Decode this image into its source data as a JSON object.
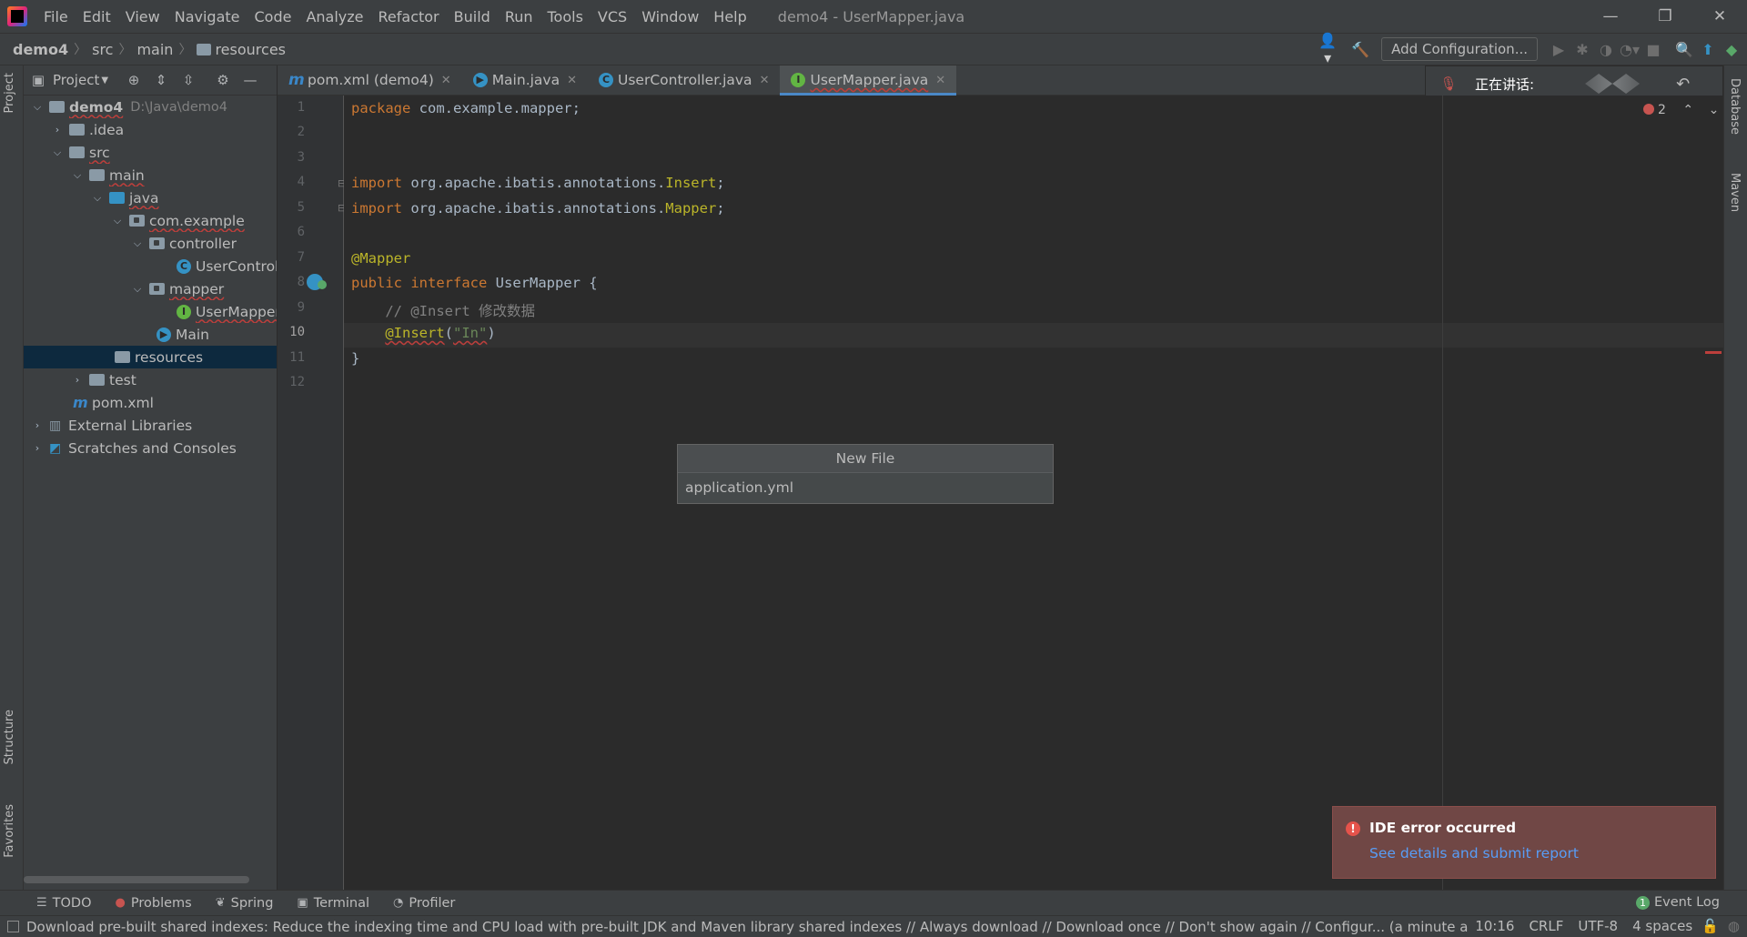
{
  "app": {
    "window_title": "demo4 - UserMapper.java",
    "menu": [
      "File",
      "Edit",
      "View",
      "Navigate",
      "Code",
      "Analyze",
      "Refactor",
      "Build",
      "Run",
      "Tools",
      "VCS",
      "Window",
      "Help"
    ]
  },
  "breadcrumb": [
    "demo4",
    "src",
    "main",
    "resources"
  ],
  "toolbar": {
    "add_configuration": "Add Configuration..."
  },
  "project_panel": {
    "title": "Project",
    "tree": [
      {
        "label": "demo4",
        "path": "D:\\Java\\demo4"
      },
      {
        "label": ".idea"
      },
      {
        "label": "src"
      },
      {
        "label": "main"
      },
      {
        "label": "java"
      },
      {
        "label": "com.example"
      },
      {
        "label": "controller"
      },
      {
        "label": "UserController"
      },
      {
        "label": "mapper"
      },
      {
        "label": "UserMapper"
      },
      {
        "label": "Main"
      },
      {
        "label": "resources"
      },
      {
        "label": "test"
      },
      {
        "label": "pom.xml"
      },
      {
        "label": "External Libraries"
      },
      {
        "label": "Scratches and Consoles"
      }
    ]
  },
  "editor_tabs": [
    {
      "label": "pom.xml (demo4)",
      "icon": "maven-icon"
    },
    {
      "label": "Main.java",
      "icon": "main-class-icon"
    },
    {
      "label": "UserController.java",
      "icon": "class-icon"
    },
    {
      "label": "UserMapper.java",
      "icon": "interface-icon",
      "active": true
    }
  ],
  "speaking_overlay": {
    "label": "正在讲话:"
  },
  "editor": {
    "line_numbers": [
      "1",
      "2",
      "3",
      "4",
      "5",
      "6",
      "7",
      "8",
      "9",
      "10",
      "11",
      "12"
    ],
    "current_line": "10",
    "error_count": "2",
    "code": {
      "l1_kw": "package",
      "l1_rest": " com.example.mapper;",
      "l4_kw": "import",
      "l4_pkg": " org.apache.ibatis.annotations.",
      "l4_cls": "Insert",
      "l5_kw": "import",
      "l5_pkg": " org.apache.ibatis.annotations.",
      "l5_cls": "Mapper",
      "l7_ann": "@Mapper",
      "l8_kw1": "public",
      "l8_kw2": " interface",
      "l8_rest": " UserMapper {",
      "l9_cmt": "    // @Insert 修改数据",
      "l10_ann": "@Insert",
      "l10_open": "(",
      "l10_str": "\"In\"",
      "l10_close": ")",
      "l11": "}"
    }
  },
  "new_file_popup": {
    "title": "New File",
    "value": "application.yml"
  },
  "ide_error": {
    "title": "IDE error occurred",
    "link": "See details and submit report"
  },
  "left_stripe": {
    "project": "Project",
    "structure": "Structure",
    "favorites": "Favorites"
  },
  "right_stripe": {
    "database": "Database",
    "maven": "Maven"
  },
  "bottom_tools": [
    {
      "label": "TODO",
      "icon": "list-icon"
    },
    {
      "label": "Problems",
      "icon": "error-icon"
    },
    {
      "label": "Spring",
      "icon": "spring-icon"
    },
    {
      "label": "Terminal",
      "icon": "terminal-icon"
    },
    {
      "label": "Profiler",
      "icon": "profiler-icon"
    }
  ],
  "event_log": {
    "label": "Event Log",
    "count": "1"
  },
  "status_bar": {
    "message": "Download pre-built shared indexes: Reduce the indexing time and CPU load with pre-built JDK and Maven library shared indexes // Always download // Download once // Don't show again // Configur... (a minute ag",
    "position": "10:16",
    "line_separator": "CRLF",
    "encoding": "UTF-8",
    "indent": "4 spaces"
  }
}
